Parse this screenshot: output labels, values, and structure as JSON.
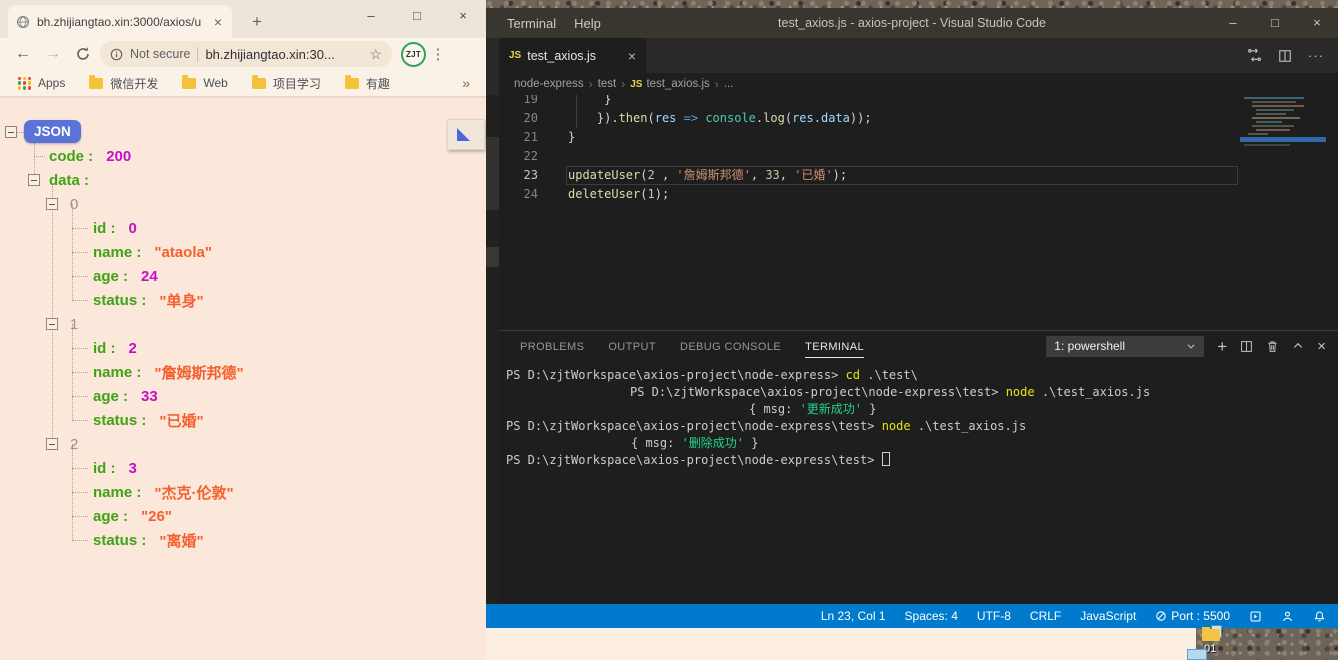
{
  "browser": {
    "tab_title": "bh.zhijiangtao.xin:3000/axios/u",
    "tab_close": "×",
    "new_tab": "+",
    "window_controls": {
      "minimize": "–",
      "maximize": "□",
      "close": "×"
    },
    "nav": {
      "back": "←",
      "forward": "→"
    },
    "omnibox": {
      "security": "Not secure",
      "url": "bh.zhijiangtao.xin:30...",
      "star": "☆"
    },
    "avatar": "ZJT",
    "menu_dots": "⋮",
    "bookmarks": {
      "apps_label": "Apps",
      "folders": [
        "微信开发",
        "Web",
        "项目学习",
        "有趣"
      ],
      "overflow": "»"
    }
  },
  "json_page": {
    "root": "JSON",
    "rows": [
      {
        "type": "kv",
        "depth": 1,
        "key": "code",
        "val": "200",
        "vt": "num"
      },
      {
        "type": "parent",
        "depth": 1,
        "key": "data"
      },
      {
        "type": "idx",
        "depth": 2,
        "label": "0"
      },
      {
        "type": "kv",
        "depth": 3,
        "key": "id",
        "val": "0",
        "vt": "num"
      },
      {
        "type": "kv",
        "depth": 3,
        "key": "name",
        "val": "\"ataola\"",
        "vt": "str"
      },
      {
        "type": "kv",
        "depth": 3,
        "key": "age",
        "val": "24",
        "vt": "num"
      },
      {
        "type": "kv",
        "depth": 3,
        "key": "status",
        "val": "\"单身\"",
        "vt": "str"
      },
      {
        "type": "idx",
        "depth": 2,
        "label": "1"
      },
      {
        "type": "kv",
        "depth": 3,
        "key": "id",
        "val": "2",
        "vt": "num"
      },
      {
        "type": "kv",
        "depth": 3,
        "key": "name",
        "val": "\"詹姆斯邦德\"",
        "vt": "str"
      },
      {
        "type": "kv",
        "depth": 3,
        "key": "age",
        "val": "33",
        "vt": "num"
      },
      {
        "type": "kv",
        "depth": 3,
        "key": "status",
        "val": "\"已婚\"",
        "vt": "str"
      },
      {
        "type": "idx",
        "depth": 2,
        "label": "2"
      },
      {
        "type": "kv",
        "depth": 3,
        "key": "id",
        "val": "3",
        "vt": "num"
      },
      {
        "type": "kv",
        "depth": 3,
        "key": "name",
        "val": "\"杰克·伦敦\"",
        "vt": "str"
      },
      {
        "type": "kv",
        "depth": 3,
        "key": "age",
        "val": "\"26\"",
        "vt": "str"
      },
      {
        "type": "kv",
        "depth": 3,
        "key": "status",
        "val": "\"离婚\"",
        "vt": "str"
      }
    ],
    "colors": {
      "key": "#3FA315",
      "number": "#C411C4",
      "string": "#F4602F",
      "badge": "#5B72D8",
      "background": "#FBE8DA"
    }
  },
  "vscode": {
    "menus": [
      "Terminal",
      "Help"
    ],
    "title": "test_axios.js - axios-project - Visual Studio Code",
    "window_controls": {
      "minimize": "–",
      "maximize": "□",
      "close": "×"
    },
    "editor_tab": {
      "icon": "JS",
      "name": "test_axios.js",
      "close": "×"
    },
    "tabbar_more": "···",
    "breadcrumbs": {
      "items": [
        "node-express",
        "test",
        "test_axios.js",
        "..."
      ],
      "js_icon": "JS",
      "sep": "›"
    },
    "code_lines": [
      {
        "n": "19",
        "tokens": [
          {
            "c": "pln",
            "t": "     }"
          }
        ]
      },
      {
        "n": "20",
        "tokens": [
          {
            "c": "pln",
            "t": "    })."
          },
          {
            "c": "fn",
            "t": "then"
          },
          {
            "c": "pln",
            "t": "("
          },
          {
            "c": "var",
            "t": "res"
          },
          {
            "c": "pln",
            "t": " "
          },
          {
            "c": "kw",
            "t": "=>"
          },
          {
            "c": "pln",
            "t": " "
          },
          {
            "c": "cls",
            "t": "console"
          },
          {
            "c": "pln",
            "t": "."
          },
          {
            "c": "fn",
            "t": "log"
          },
          {
            "c": "pln",
            "t": "("
          },
          {
            "c": "var",
            "t": "res"
          },
          {
            "c": "pln",
            "t": "."
          },
          {
            "c": "var",
            "t": "data"
          },
          {
            "c": "pln",
            "t": "));"
          }
        ]
      },
      {
        "n": "21",
        "tokens": [
          {
            "c": "pln",
            "t": "}"
          }
        ]
      },
      {
        "n": "22",
        "tokens": []
      },
      {
        "n": "23",
        "current": true,
        "tokens": [
          {
            "c": "fn",
            "t": "updateUser"
          },
          {
            "c": "pln",
            "t": "("
          },
          {
            "c": "num",
            "t": "2"
          },
          {
            "c": "pln",
            "t": " , "
          },
          {
            "c": "str",
            "t": "'詹姆斯邦德'"
          },
          {
            "c": "pln",
            "t": ", "
          },
          {
            "c": "num",
            "t": "33"
          },
          {
            "c": "pln",
            "t": ", "
          },
          {
            "c": "str",
            "t": "'已婚'"
          },
          {
            "c": "pln",
            "t": ");"
          }
        ]
      },
      {
        "n": "24",
        "tokens": [
          {
            "c": "fn",
            "t": "deleteUser"
          },
          {
            "c": "pln",
            "t": "("
          },
          {
            "c": "num",
            "t": "1"
          },
          {
            "c": "pln",
            "t": ");"
          }
        ]
      }
    ],
    "panel_tabs": [
      {
        "label": "PROBLEMS"
      },
      {
        "label": "OUTPUT"
      },
      {
        "label": "DEBUG CONSOLE"
      },
      {
        "label": "TERMINAL",
        "active": true
      }
    ],
    "terminal_dropdown": "1: powershell",
    "terminal_lines": [
      {
        "indent": 0,
        "segs": [
          {
            "c": "p",
            "t": "PS D:\\zjtWorkspace\\axios-project\\node-express>"
          },
          {
            "c": "t",
            "t": " "
          },
          {
            "c": "c",
            "t": "cd"
          },
          {
            "c": "t",
            "t": " .\\test\\"
          }
        ]
      },
      {
        "indent": 124,
        "segs": [
          {
            "c": "p",
            "t": "PS D:\\zjtWorkspace\\axios-project\\node-express\\test>"
          },
          {
            "c": "t",
            "t": " "
          },
          {
            "c": "c",
            "t": "node"
          },
          {
            "c": "t",
            "t": " .\\test_axios.js"
          }
        ]
      },
      {
        "indent": 243,
        "segs": [
          {
            "c": "t",
            "t": "{ msg: "
          },
          {
            "c": "g",
            "t": "'更新成功'"
          },
          {
            "c": "t",
            "t": " }"
          }
        ]
      },
      {
        "indent": 0,
        "segs": [
          {
            "c": "p",
            "t": "PS D:\\zjtWorkspace\\axios-project\\node-express\\test>"
          },
          {
            "c": "t",
            "t": " "
          },
          {
            "c": "c",
            "t": "node"
          },
          {
            "c": "t",
            "t": " .\\test_axios.js"
          }
        ]
      },
      {
        "indent": 125,
        "segs": [
          {
            "c": "t",
            "t": "{ msg: "
          },
          {
            "c": "g",
            "t": "'删除成功'"
          },
          {
            "c": "t",
            "t": " }"
          }
        ]
      },
      {
        "indent": 0,
        "segs": [
          {
            "c": "p",
            "t": "PS D:\\zjtWorkspace\\axios-project\\node-express\\test>"
          },
          {
            "c": "t",
            "t": " "
          },
          {
            "c": "cur",
            "t": ""
          }
        ]
      }
    ],
    "status_bar": {
      "line_col": "Ln 23, Col 1",
      "spaces": "Spaces: 4",
      "encoding": "UTF-8",
      "eol": "CRLF",
      "language": "JavaScript",
      "port": "Port : 5500",
      "color": "#007ACC"
    }
  },
  "desktop": {
    "icon_label": "01"
  }
}
